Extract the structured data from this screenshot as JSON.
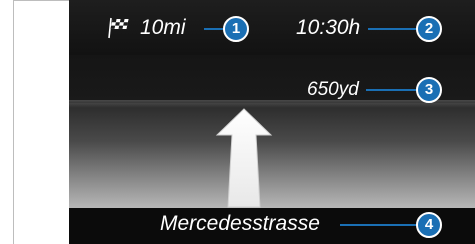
{
  "nav": {
    "distance_to_destination": "10mi",
    "arrival_time": "10:30h",
    "distance_to_maneuver": "650yd",
    "street_name": "Mercedesstrasse",
    "maneuver_icon": "straight-arrow-icon",
    "destination_icon": "checkered-flag-icon"
  },
  "callouts": [
    "1",
    "2",
    "3",
    "4"
  ],
  "colors": {
    "callout_blue": "#1a6fb4",
    "screen_background": "#0d0d0d",
    "text": "#ffffff"
  }
}
